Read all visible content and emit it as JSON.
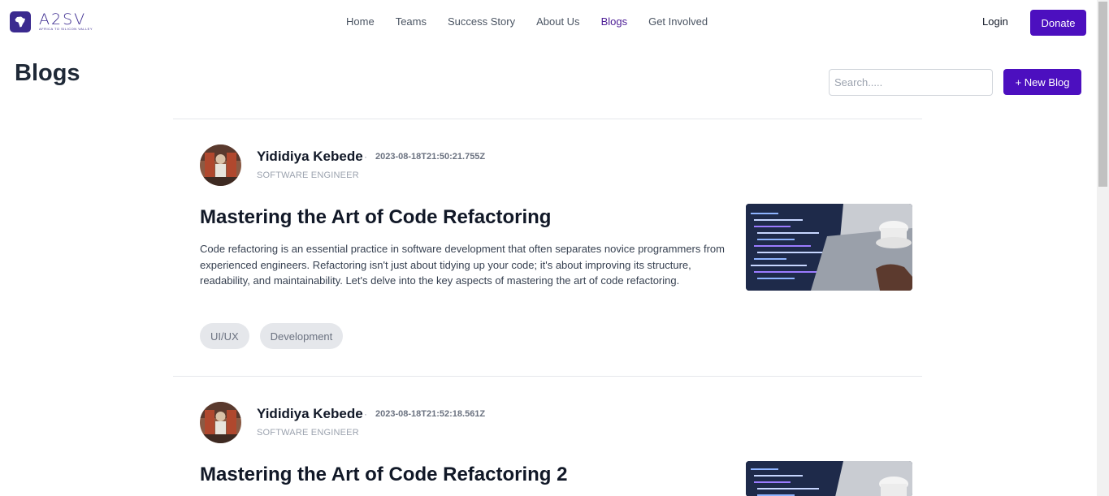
{
  "brand": {
    "name": "A2SV",
    "tagline": "AFRICA TO SILICON VALLEY"
  },
  "nav": {
    "links": [
      {
        "label": "Home",
        "active": false
      },
      {
        "label": "Teams",
        "active": false
      },
      {
        "label": "Success Story",
        "active": false
      },
      {
        "label": "About Us",
        "active": false
      },
      {
        "label": "Blogs",
        "active": true
      },
      {
        "label": "Get Involved",
        "active": false
      }
    ],
    "login": "Login",
    "donate": "Donate"
  },
  "page": {
    "title": "Blogs",
    "search_placeholder": "Search.....",
    "new_blog": "+ New Blog"
  },
  "posts": [
    {
      "author": "Yididiya Kebede",
      "date": "2023-08-18T21:50:21.755Z",
      "role": "SOFTWARE ENGINEER",
      "title": "Mastering the Art of Code Refactoring",
      "excerpt": "Code refactoring is an essential practice in software development that often separates novice programmers from experienced engineers. Refactoring isn't just about tidying up your code; it's about improving its structure, readability, and maintainability. Let's delve into the key aspects of mastering the art of code refactoring.",
      "tags": [
        "UI/UX",
        "Development"
      ]
    },
    {
      "author": "Yididiya Kebede",
      "date": "2023-08-18T21:52:18.561Z",
      "role": "SOFTWARE ENGINEER",
      "title": "Mastering the Art of Code Refactoring 2",
      "excerpt": "",
      "tags": []
    }
  ],
  "colors": {
    "accent": "#4c0fbf",
    "active_nav": "#4c1d95"
  }
}
